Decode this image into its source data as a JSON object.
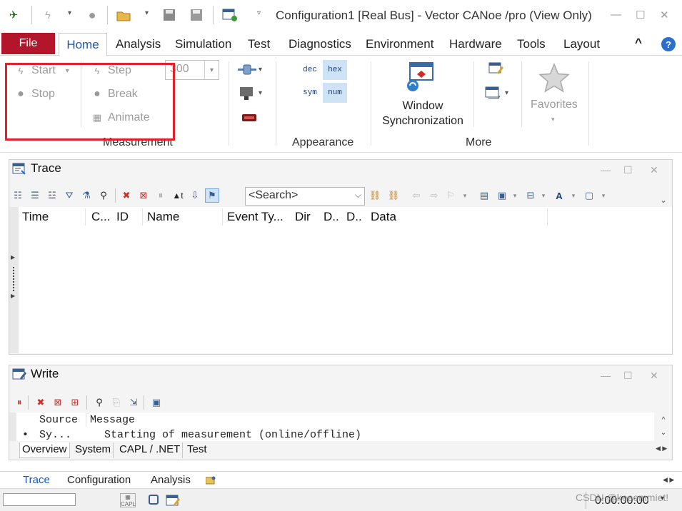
{
  "window": {
    "title": "Configuration1 [Real Bus] - Vector CANoe /pro (View Only)",
    "controls": {
      "minimize": "—",
      "maximize": "☐",
      "close": "✕"
    }
  },
  "quick_access": {
    "icons": [
      "app-logo-icon",
      "lightning-icon",
      "record-icon",
      "open-folder-icon",
      "save-icon",
      "save-all-icon",
      "config-icon"
    ]
  },
  "menu": {
    "file": "File",
    "tabs": [
      "Home",
      "Analysis",
      "Simulation",
      "Test",
      "Diagnostics",
      "Environment",
      "Hardware",
      "Tools",
      "Layout"
    ],
    "active": "Home",
    "collapse_glyph": "^",
    "help_glyph": "?"
  },
  "ribbon": {
    "measurement": {
      "start": "Start",
      "stop": "Stop",
      "step": "Step",
      "break": "Break",
      "animate": "Animate",
      "speed_value": "300",
      "label": "Measurement"
    },
    "appearance": {
      "dec": "dec",
      "hex": "hex",
      "sym": "sym",
      "num": "num",
      "label": "Appearance"
    },
    "more": {
      "window_sync_line1": "Window",
      "window_sync_line2": "Synchronization",
      "label": "More"
    },
    "favorites": "Favorites"
  },
  "trace": {
    "title": "Trace",
    "search_placeholder": "<Search>",
    "columns": [
      "Time",
      "C...",
      "ID",
      "Name",
      "Event Ty...",
      "Dir",
      "D..",
      "D..",
      "Data"
    ],
    "win_controls": {
      "minimize": "—",
      "maximize": "☐",
      "close": "✕"
    }
  },
  "write": {
    "title": "Write",
    "header": {
      "source": "Source",
      "message": "Message"
    },
    "rows": [
      {
        "bullet": "•",
        "source": "Sy...",
        "message": "Starting of measurement (online/offline)"
      }
    ],
    "tabs": [
      "Overview",
      "System",
      "CAPL / .NET",
      "Test"
    ],
    "win_controls": {
      "minimize": "—",
      "maximize": "☐",
      "close": "✕"
    }
  },
  "bottom_tabs": [
    "Trace",
    "Configuration",
    "Analysis"
  ],
  "status": {
    "time": "0:00:00:00",
    "watermark": "CSDN @keeemmiet!"
  },
  "colors": {
    "file_tab": "#b3162a",
    "active_tab_text": "#1a56b8",
    "highlight_box": "#e0232a",
    "hex_num_bg": "#cfe3f6"
  }
}
